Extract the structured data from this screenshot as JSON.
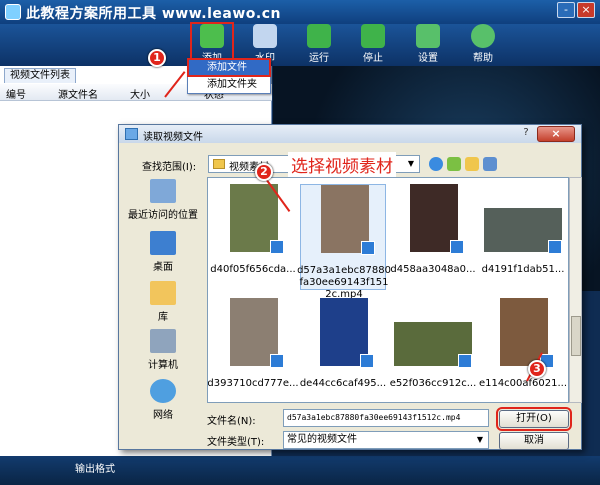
{
  "app": {
    "title": "此教程方案所用工具 www.leawo.cn",
    "window_controls": [
      "-",
      "×"
    ]
  },
  "toolbar": {
    "items": [
      {
        "key": "add",
        "label": "添加",
        "icon": "add-video-icon",
        "color": "#4dbe4d"
      },
      {
        "key": "watermark",
        "label": "水印",
        "icon": "watermark-icon",
        "color": "#c2d6ef"
      },
      {
        "key": "run",
        "label": "运行",
        "icon": "run-arrow-icon",
        "color": "#3fb34a"
      },
      {
        "key": "stop",
        "label": "停止",
        "icon": "stop-icon",
        "color": "#3fb34a"
      },
      {
        "key": "settings",
        "label": "设置",
        "icon": "settings-icon",
        "color": "#58c06a"
      },
      {
        "key": "help",
        "label": "帮助",
        "icon": "help-icon",
        "color": "#58c06a"
      }
    ]
  },
  "add_menu": {
    "items": [
      "添加文件",
      "添加文件夹"
    ],
    "selected_index": 0
  },
  "file_list": {
    "tab": "视频文件列表",
    "columns": [
      "编号",
      "源文件名",
      "大小",
      "状态"
    ]
  },
  "bottom": {
    "output_format_label": "输出格式"
  },
  "dialog": {
    "title": "读取视频文件",
    "help": "?",
    "close": "×",
    "look_in_label": "查找范围(I):",
    "look_in_value": "视频素材",
    "places": [
      {
        "label": "最近访问的位置",
        "icon": "recent-places-icon",
        "color": "#7fa8d8"
      },
      {
        "label": "桌面",
        "icon": "desktop-icon",
        "color": "#3d7fd0"
      },
      {
        "label": "库",
        "icon": "library-icon",
        "color": "#f2c55c"
      },
      {
        "label": "计算机",
        "icon": "computer-icon",
        "color": "#8fa4bd"
      },
      {
        "label": "网络",
        "icon": "network-icon",
        "color": "#4f9fe0"
      }
    ],
    "files": [
      {
        "name": "d40f05f656cda...",
        "color": "#6b7a4a",
        "wide": false,
        "selected": false
      },
      {
        "name": "d57a3a1ebc87880fa30ee69143f1512c.mp4",
        "color": "#8a7462",
        "wide": false,
        "selected": true
      },
      {
        "name": "d458aa3048a0...",
        "color": "#3e2a26",
        "wide": false,
        "selected": false
      },
      {
        "name": "d4191f1dab51...",
        "color": "#55605a",
        "wide": true,
        "selected": false
      },
      {
        "name": "d393710cd777e...",
        "color": "#8c7f72",
        "wide": false,
        "selected": false
      },
      {
        "name": "de44cc6caf495...",
        "color": "#1e3f8a",
        "wide": false,
        "selected": false
      },
      {
        "name": "e52f036cc912c...",
        "color": "#5a6b3c",
        "wide": true,
        "selected": false
      },
      {
        "name": "e114c00af6021...",
        "color": "#7d5a3e",
        "wide": false,
        "selected": false
      }
    ],
    "filename_label": "文件名(N):",
    "filename_value": "d57a3a1ebc87880fa30ee69143f1512c.mp4",
    "filetype_label": "文件类型(T):",
    "filetype_value": "常见的视频文件",
    "open_button": "打开(O)",
    "cancel_button": "取消"
  },
  "annotations": {
    "step1": "1",
    "step2": "2",
    "step3": "3",
    "callout": "选择视频素材",
    "color": "#e0251b"
  }
}
